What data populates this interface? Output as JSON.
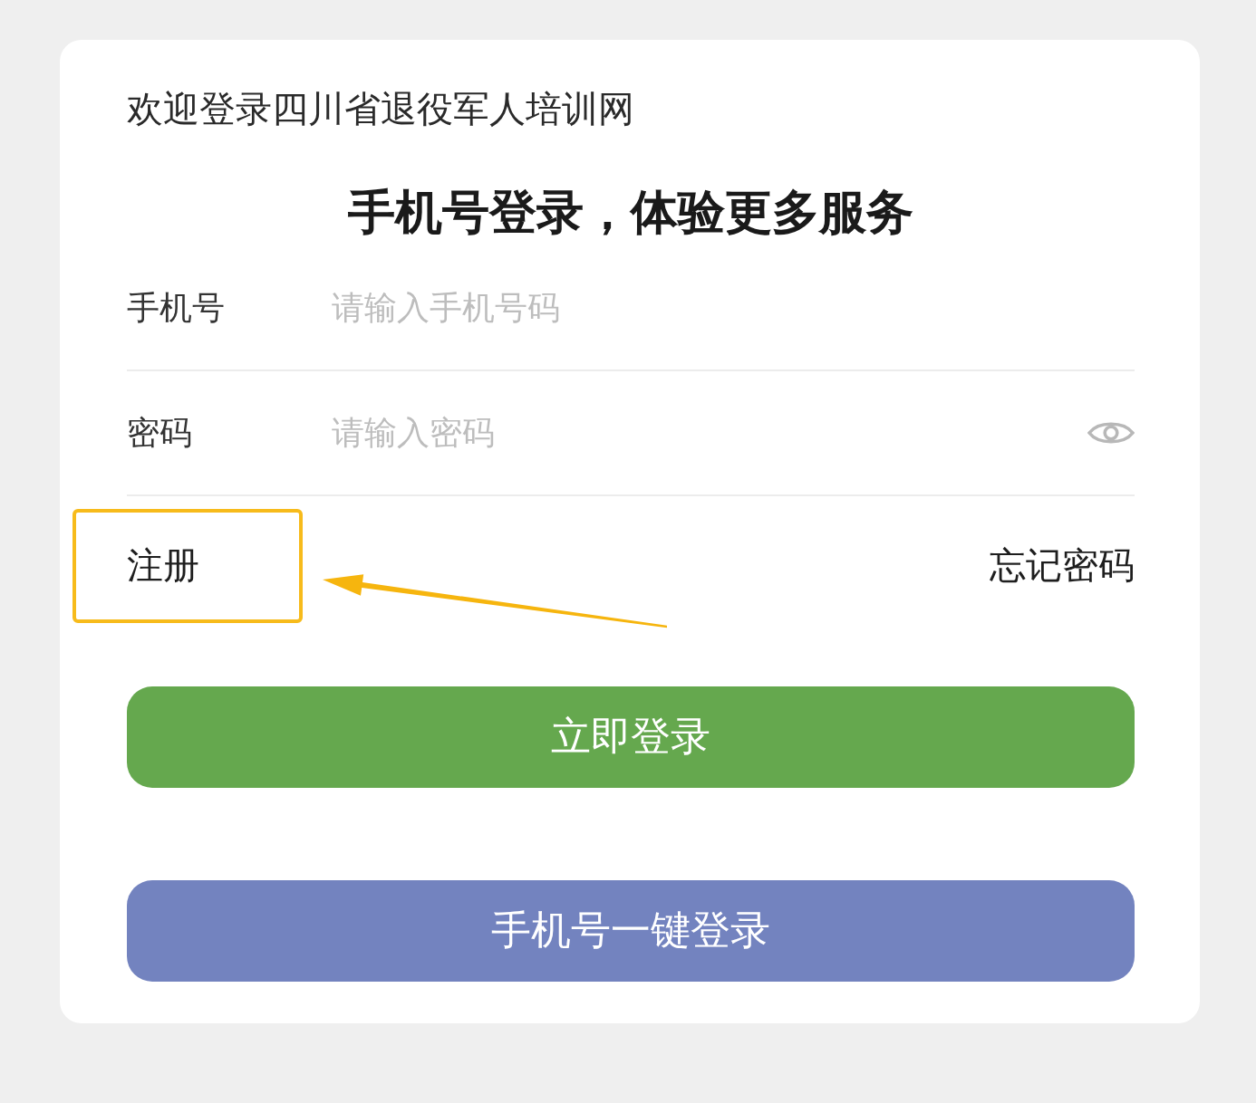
{
  "welcome": "欢迎登录四川省退役军人培训网",
  "headline": "手机号登录，体验更多服务",
  "fields": [
    {
      "kind": "text",
      "label": "手机号",
      "placeholder": "请输入手机号码"
    },
    {
      "kind": "password",
      "label": "密码",
      "placeholder": "请输入密码"
    }
  ],
  "links": {
    "register": "注册",
    "forgot": "忘记密码"
  },
  "buttons": [
    {
      "label": "立即登录",
      "color": "#65a84e"
    },
    {
      "label": "手机号一键登录",
      "color": "#7383bf"
    }
  ]
}
